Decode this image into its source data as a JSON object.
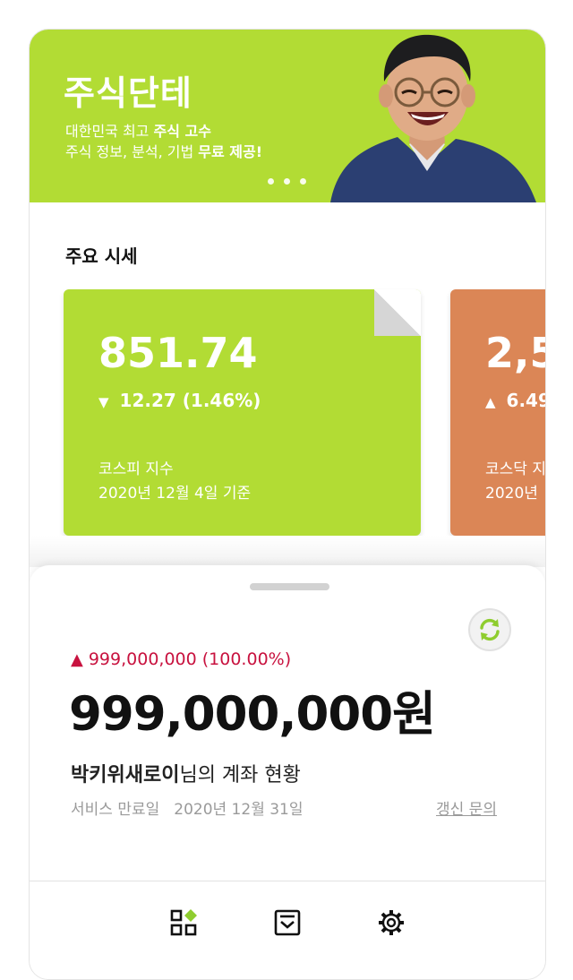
{
  "banner": {
    "title": "주식단테",
    "line1_prefix": "대한민국 최고 ",
    "line1_bold": "주식 고수",
    "line2_prefix": "주식 정보, 분석, 기법 ",
    "line2_bold": "무료 제공!",
    "pager_dots": 3
  },
  "market": {
    "section_title": "주요 시세",
    "cards": [
      {
        "value": "851.74",
        "direction": "down",
        "direction_icon": "▼",
        "change": "12.27 (1.46%)",
        "name": "코스피 지수",
        "date": "2020년 12월 4일 기준",
        "color": "#b2dc34"
      },
      {
        "value": "2,5",
        "direction": "up",
        "direction_icon": "▲",
        "change": "6.49",
        "name": "코스닥 지",
        "date": "2020년",
        "color": "#db8656"
      }
    ]
  },
  "account": {
    "change_icon": "▲",
    "change": "999,000,000 (100.00%)",
    "balance": "999,000,000원",
    "owner_name": "박키위새로이",
    "owner_suffix": "님의 계좌 현황",
    "expire_label": "서비스 만료일",
    "expire_date": "2020년 12월 31일",
    "renew_link": "갱신 문의",
    "accent_color": "#c8123f"
  },
  "tabbar": {
    "items": [
      {
        "icon": "dashboard-icon",
        "active": true
      },
      {
        "icon": "inbox-icon",
        "active": false
      },
      {
        "icon": "gear-icon",
        "active": false
      }
    ],
    "active_color": "#8fcd2f"
  }
}
